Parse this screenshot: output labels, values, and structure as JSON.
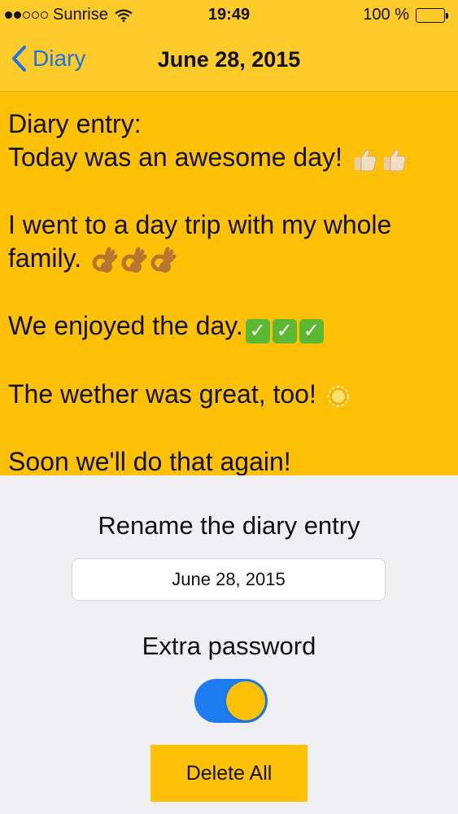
{
  "status_bar": {
    "carrier": "Sunrise",
    "time": "19:49",
    "battery": "100 %",
    "battery_level": 1.0
  },
  "nav": {
    "back_label": "Diary",
    "title": "June 28, 2015"
  },
  "entry": {
    "line1": "Diary entry:",
    "line2": "Today was an awesome day!",
    "line3": "I went to a day trip with my whole family.",
    "line4": "We enjoyed the day.",
    "line5": "The wether was great, too!",
    "line6": "Soon we'll do that again!",
    "icons": [
      "thumbs-up-icon",
      "ok-hand-icon",
      "check-mark-icon",
      "sun-icon"
    ]
  },
  "settings": {
    "rename_label": "Rename the diary entry",
    "rename_value": "June 28, 2015",
    "password_label": "Extra password",
    "password_enabled": true,
    "delete_label": "Delete All"
  },
  "colors": {
    "accent_yellow": "#ffc107",
    "link_blue": "#1a73e8",
    "toggle_blue": "#1e7cf2",
    "background_gray": "#efeff4"
  }
}
